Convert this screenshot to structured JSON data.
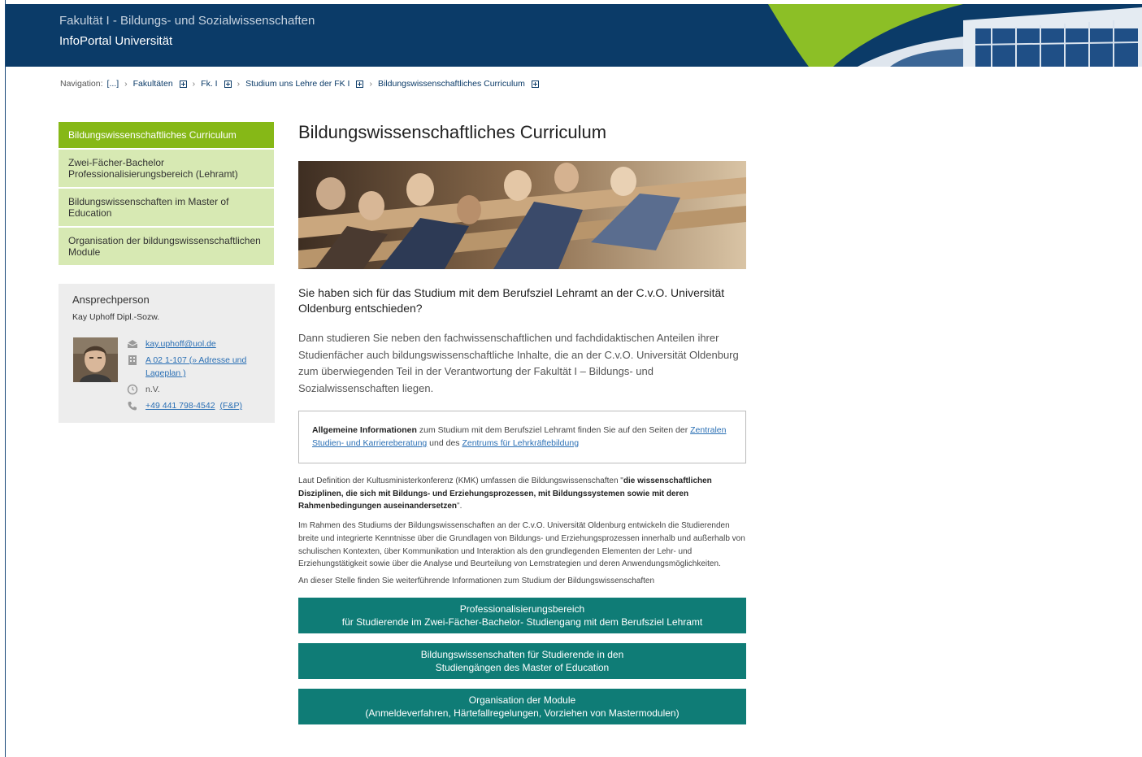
{
  "header": {
    "faculty": "Fakultät I - Bildungs- und Sozialwissenschaften",
    "portal": "InfoPortal Universität"
  },
  "breadcrumb": {
    "prefix": "Navigation:",
    "items": [
      "[...]",
      "Fakultäten",
      "Fk. I",
      "Studium uns Lehre der FK I",
      "Bildungswissenschaftliches Curriculum"
    ]
  },
  "sidebar": {
    "items": [
      {
        "label": "Bildungswissenschaftliches Curriculum"
      },
      {
        "label": "Zwei-Fächer-Bachelor Professionalisierungsbereich (Lehramt)"
      },
      {
        "label": "Bildungswissenschaften im Master of Education"
      },
      {
        "label": "Organisation der bildungswissenschaftlichen Module"
      }
    ]
  },
  "contact": {
    "title": "Ansprechperson",
    "name": "Kay Uphoff Dipl.-Sozw.",
    "email": "kay.uphoff@uol.de",
    "room": "A 02 1-107 (» Adresse und Lageplan )",
    "hours": "n.V.",
    "phone": "+49 441 798-4542",
    "phone_extra": "(F&P)"
  },
  "main": {
    "title": "Bildungswissenschaftliches Curriculum",
    "lead": "Sie haben sich für das Studium mit dem Berufsziel Lehramt an der C.v.O. Universität Oldenburg entschieden?",
    "intro": "Dann studieren Sie neben den fachwissenschaftlichen und fachdidaktischen Anteilen ihrer Studienfächer auch bildungswissenschaftliche Inhalte, die an der C.v.O. Universität Oldenburg zum überwiegenden Teil in der Verantwortung der Fakultät I – Bildungs- und Sozialwissenschaften liegen.",
    "infobox": {
      "bold": "Allgemeine Informationen",
      "text1": " zum Studium mit dem Berufsziel Lehramt finden Sie auf den Seiten der ",
      "link1": "Zentralen Studien- und Karriereberatung",
      "text2": " und des ",
      "link2": "Zentrums für Lehrkräftebildung"
    },
    "para1_a": "Laut Definition der Kultusministerkonferenz (KMK) umfassen die Bildungswissenschaften \"",
    "para1_b": "die wissenschaftlichen Disziplinen, die sich mit Bildungs- und Erziehungsprozessen, mit Bildungssystemen sowie mit deren Rahmenbedingungen auseinandersetzen",
    "para1_c": "\".",
    "para2": "Im Rahmen des Studiums der Bildungswissenschaften an der C.v.O. Universität Oldenburg entwickeln die Studierenden breite und integrierte Kenntnisse über die Grundlagen von Bildungs- und Erziehungsprozessen innerhalb und außerhalb von schulischen Kontexten, über Kommunikation und Interaktion als den grundlegenden Elementen der Lehr- und Erziehungstätigkeit sowie über die Analyse und Beurteilung von Lernstrategien und deren Anwendungsmöglichkeiten.",
    "para3": "An dieser Stelle finden Sie weiterführende Informationen zum Studium der Bildungswissenschaften",
    "buttons": [
      {
        "line1": "Professionalisierungsbereich",
        "line2": "für Studierende im Zwei-Fächer-Bachelor- Studiengang mit dem Berufsziel Lehramt"
      },
      {
        "line1": "Bildungswissenschaften für Studierende in den",
        "line2": "Studiengängen des Master of Education"
      },
      {
        "line1": "Organisation der Module",
        "line2": "(Anmeldeverfahren, Härtefallregelungen, Vorziehen von Mastermodulen)"
      }
    ]
  },
  "colors": {
    "header": "#0b3b68",
    "accent_green": "#86b817",
    "nav_light": "#d7e9b3",
    "button_teal": "#0f7c76"
  }
}
